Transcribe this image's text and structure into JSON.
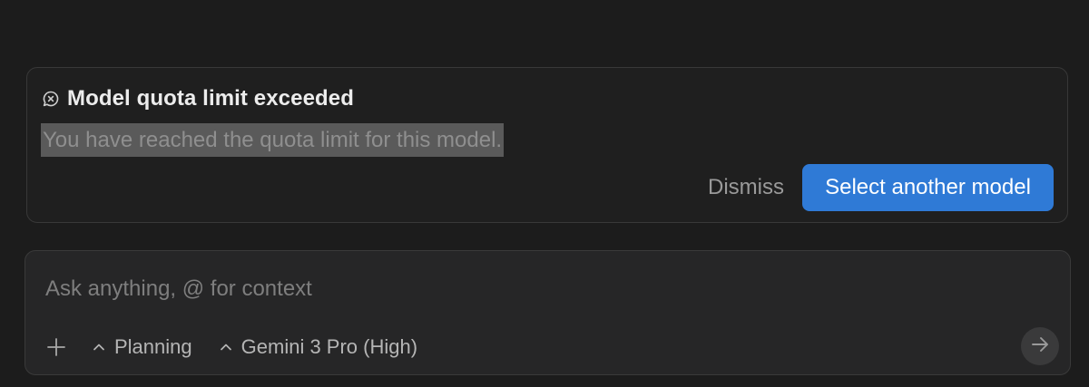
{
  "quota_alert": {
    "icon": "error-chat-icon",
    "title": "Model quota limit exceeded",
    "message": "You have reached the quota limit for this model.",
    "dismiss_label": "Dismiss",
    "select_model_label": "Select another model",
    "accent_color": "#2f7ad6"
  },
  "composer": {
    "placeholder": "Ask anything, @ for context",
    "value": "",
    "add_icon": "plus-icon",
    "mode": {
      "icon": "chevron-up-icon",
      "label": "Planning"
    },
    "model": {
      "icon": "chevron-up-icon",
      "label": "Gemini 3 Pro (High)"
    },
    "send_icon": "arrow-right-icon"
  }
}
